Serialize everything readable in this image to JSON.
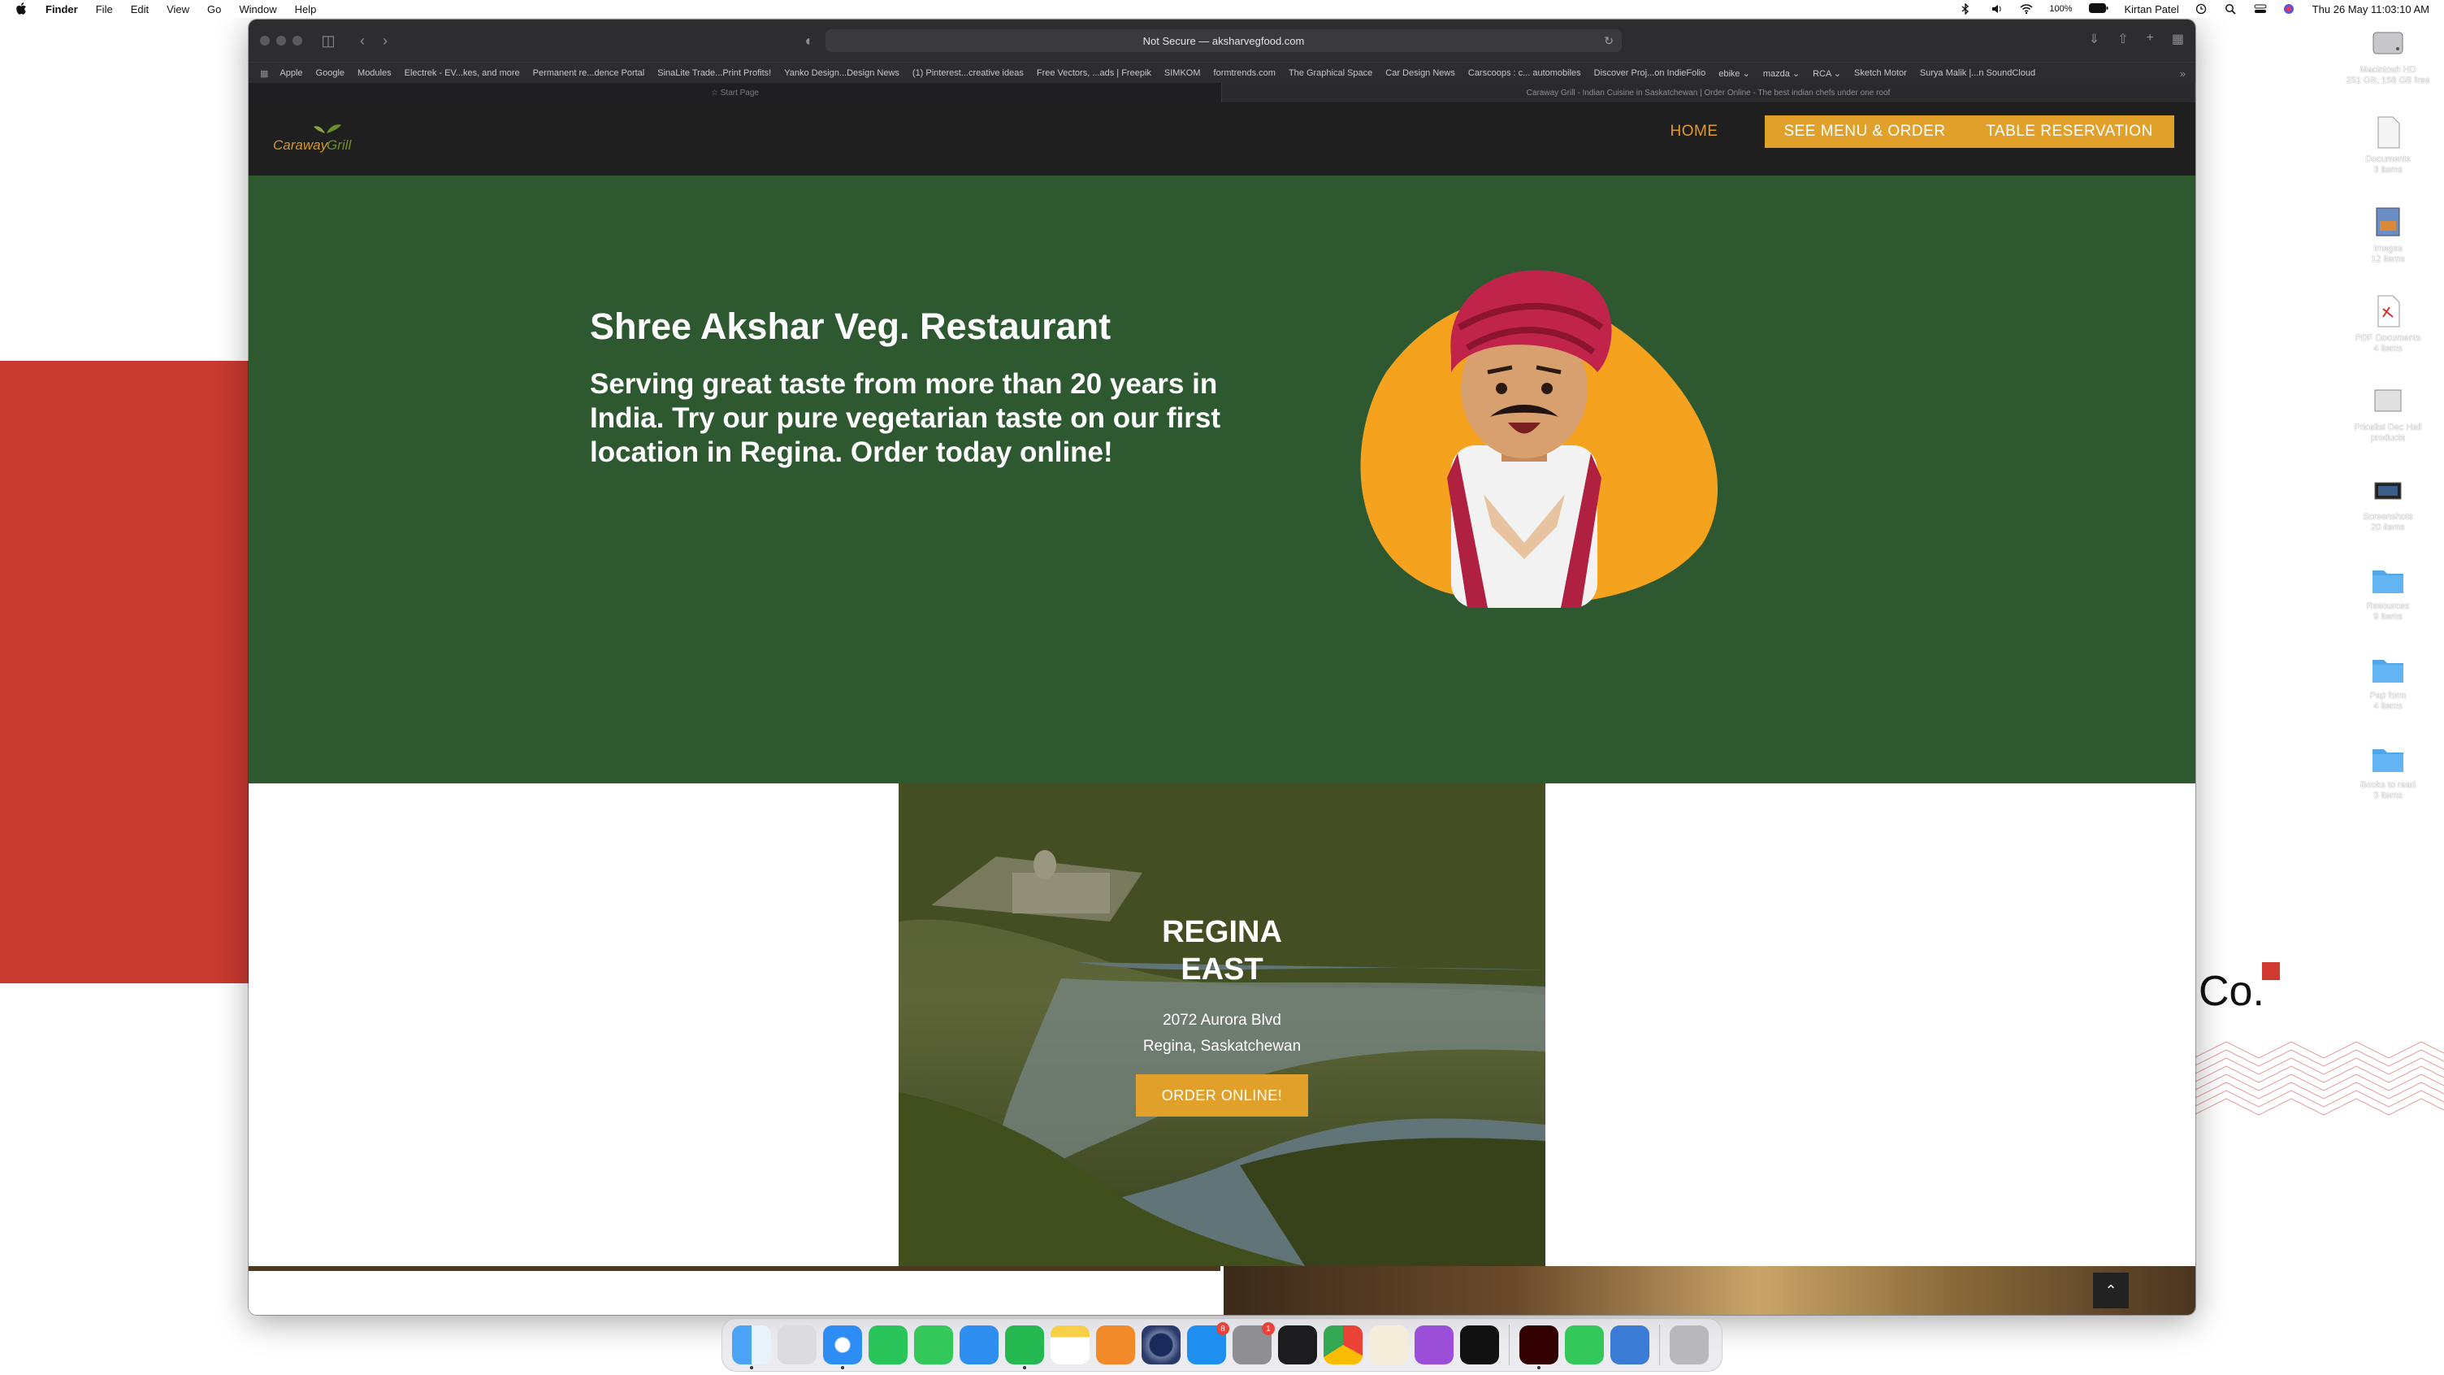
{
  "menubar": {
    "app": "Finder",
    "items": [
      "File",
      "Edit",
      "View",
      "Go",
      "Window",
      "Help"
    ],
    "battery": "100%",
    "user": "Kirtan Patel",
    "datetime": "Thu 26 May  11:03:10 AM"
  },
  "browser": {
    "url": "Not Secure — aksharvegfood.com",
    "favorites": [
      "Apple",
      "Google",
      "Modules",
      "Electrek - EV...kes, and more",
      "Permanent re...dence Portal",
      "SinaLite Trade...Print Profits!",
      "Yanko Design...Design News",
      "(1) Pinterest...creative ideas",
      "Free Vectors, ...ads | Freepik",
      "SIMKOM",
      "formtrends.com",
      "The Graphical Space",
      "Car Design News",
      "Carscoops : c... automobiles",
      "Discover Proj...on IndieFolio",
      "ebike ⌄",
      "mazda ⌄",
      "RCA ⌄",
      "Sketch Motor",
      "Surya Malik |...n SoundCloud"
    ],
    "tabs": [
      "☆  Start Page",
      "Caraway Grill - Indian Cuisine in Saskatchewan | Order Online - The best indian chefs under one roof"
    ]
  },
  "site": {
    "brand_word1": "Caraway",
    "brand_word2": "Grill",
    "nav": {
      "home": "HOME",
      "menu": "SEE MENU & ORDER",
      "reservation": "TABLE RESERVATION"
    },
    "hero": {
      "title": "Shree Akshar Veg. Restaurant",
      "text": "Serving great taste from more than 20 years in India. Try our pure vegetarian taste on our first location in Regina. Order today online!"
    },
    "location": {
      "title_line1": "REGINA",
      "title_line2": "EAST",
      "address_line1": "2072 Aurora Blvd",
      "address_line2": "Regina, Saskatchewan",
      "cta": "ORDER ONLINE!"
    }
  },
  "desktop": {
    "co_logo": "Co.",
    "icons": [
      {
        "name": "Macintosh HD",
        "sub": "251 GB, 158 GB free"
      },
      {
        "name": "Documents",
        "sub": "3 items"
      },
      {
        "name": "Images",
        "sub": "12 items"
      },
      {
        "name": "PDF Documents",
        "sub": "4 items"
      },
      {
        "name": "Pricelist Dec Hall",
        "sub": "products"
      },
      {
        "name": "Screenshots",
        "sub": "20 items"
      },
      {
        "name": "Resources",
        "sub": "9 items"
      },
      {
        "name": "Pap form",
        "sub": "4 items"
      },
      {
        "name": "Books to read",
        "sub": "3 items"
      }
    ]
  },
  "dock": {
    "apps": [
      "Finder",
      "Launchpad",
      "Safari",
      "WhatsApp",
      "Messages",
      "Mail",
      "WhatsApp Business",
      "Notes",
      "Books",
      "Cinema 4D",
      "App Store",
      "System Preferences",
      "Activity Monitor",
      "Chrome",
      "Script Editor",
      "Podcasts",
      "TV",
      "Illustrator",
      "FaceTime",
      "Archive",
      "Trash"
    ],
    "appstore_badge": "8",
    "sysprefs_badge": "1"
  }
}
